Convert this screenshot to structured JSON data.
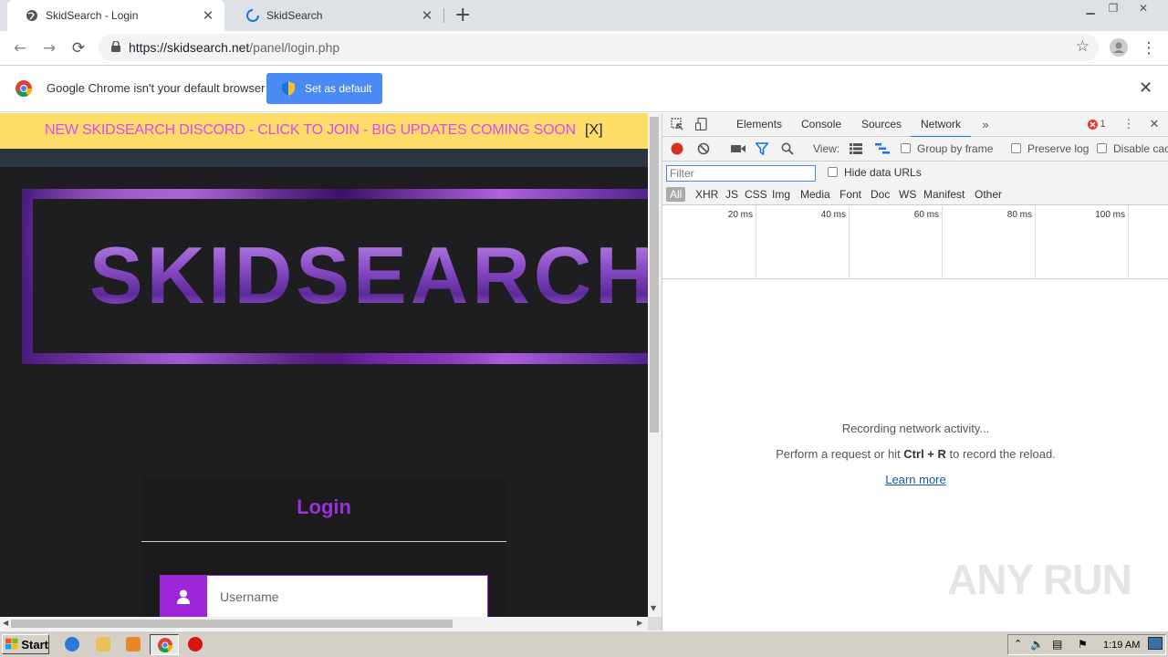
{
  "browser": {
    "tabs": [
      {
        "title": "SkidSearch - Login",
        "active": true
      },
      {
        "title": "SkidSearch",
        "active": false
      }
    ],
    "address": {
      "url_host": "https://skidsearch.net",
      "url_path": "/panel/login.php"
    },
    "infobar": {
      "message": "Google Chrome isn't your default browser",
      "button": "Set as default"
    }
  },
  "page": {
    "banner_text": "NEW SKIDSEARCH DISCORD - CLICK TO JOIN - BIG UPDATES COMING SOON",
    "banner_close": "[X]",
    "logo_text": "SKIDSEARCH",
    "login_title": "Login",
    "username_placeholder": "Username"
  },
  "devtools": {
    "tabs": [
      "Elements",
      "Console",
      "Sources",
      "Network"
    ],
    "active_tab": "Network",
    "error_count": "1",
    "view_label": "View:",
    "group_by_frame": "Group by frame",
    "preserve_log": "Preserve log",
    "disable_cache": "Disable cac",
    "filter_placeholder": "Filter",
    "hide_data_urls": "Hide data URLs",
    "types": [
      "All",
      "XHR",
      "JS",
      "CSS",
      "Img",
      "Media",
      "Font",
      "Doc",
      "WS",
      "Manifest",
      "Other"
    ],
    "timeline_ticks": [
      "20 ms",
      "40 ms",
      "60 ms",
      "80 ms",
      "100 ms"
    ],
    "empty_line1": "Recording network activity...",
    "empty_line2_pre": "Perform a request or hit ",
    "empty_line2_keys": "Ctrl + R",
    "empty_line2_post": " to record the reload.",
    "learn_more": "Learn more",
    "watermark": "ANY RUN"
  },
  "taskbar": {
    "start_label": "Start",
    "clock": "1:19 AM"
  },
  "colors": {
    "accent_purple": "#9c27d8",
    "banner_bg": "#fddc67",
    "banner_text": "#d84cf2",
    "chrome_blue": "#4a8af4"
  }
}
